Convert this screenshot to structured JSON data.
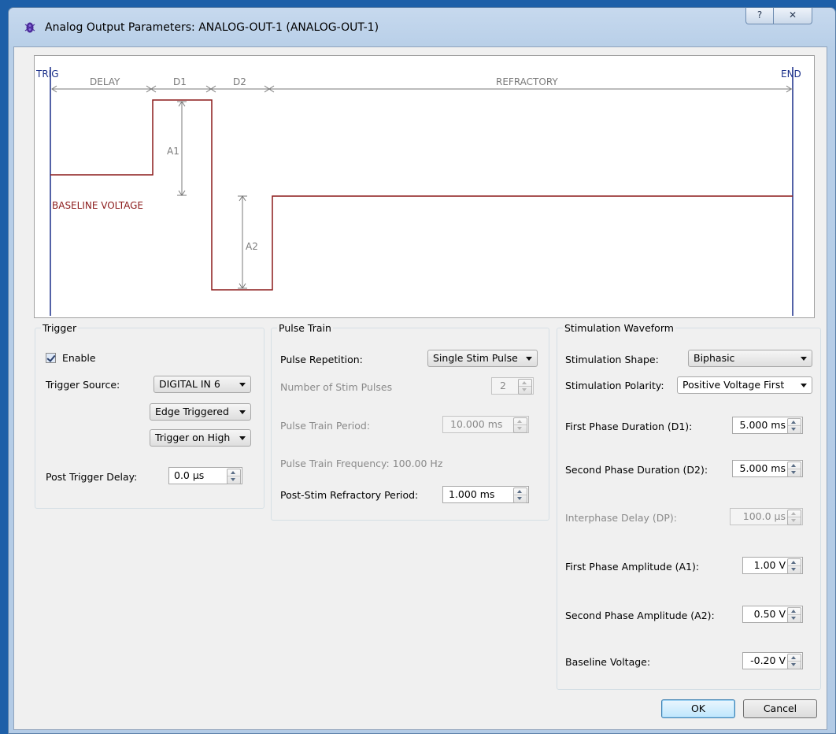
{
  "window": {
    "title": "Analog Output Parameters: ANALOG-OUT-1 (ANALOG-OUT-1)",
    "help_glyph": "?",
    "close_glyph": "✕"
  },
  "waveform": {
    "trig": "TRIG",
    "end": "END",
    "delay": "DELAY",
    "d1": "D1",
    "d2": "D2",
    "refractory": "REFRACTORY",
    "a1": "A1",
    "a2": "A2",
    "baseline": "BASELINE VOLTAGE",
    "colors": {
      "trace": "#8b1a1a",
      "marker": "#1a2f8a",
      "dim": "#7a7a7a"
    }
  },
  "trigger": {
    "title": "Trigger",
    "enable_label": "Enable",
    "enable_checked": true,
    "source_label": "Trigger Source:",
    "source_value": "DIGITAL IN 6",
    "edge_value": "Edge Triggered",
    "level_value": "Trigger on High",
    "delay_label": "Post Trigger Delay:",
    "delay_value": "0.0 µs"
  },
  "pulse_train": {
    "title": "Pulse Train",
    "repetition_label": "Pulse Repetition:",
    "repetition_value": "Single Stim Pulse",
    "num_pulses_label": "Number of Stim Pulses",
    "num_pulses_value": "2",
    "period_label": "Pulse Train Period:",
    "period_value": "10.000 ms",
    "frequency_text": "Pulse Train Frequency: 100.00 Hz",
    "refractory_label": "Post-Stim Refractory Period:",
    "refractory_value": "1.000 ms"
  },
  "stim_waveform": {
    "title": "Stimulation Waveform",
    "shape_label": "Stimulation Shape:",
    "shape_value": "Biphasic",
    "polarity_label": "Stimulation Polarity:",
    "polarity_value": "Positive Voltage First",
    "d1_label": "First Phase Duration (D1):",
    "d1_value": "5.000 ms",
    "d2_label": "Second Phase Duration (D2):",
    "d2_value": "5.000 ms",
    "dp_label": "Interphase Delay (DP):",
    "dp_value": "100.0 µs",
    "a1_label": "First Phase Amplitude (A1):",
    "a1_value": "1.00 V",
    "a2_label": "Second Phase Amplitude (A2):",
    "a2_value": "0.50 V",
    "baseline_label": "Baseline Voltage:",
    "baseline_value": "-0.20 V"
  },
  "buttons": {
    "ok": "OK",
    "cancel": "Cancel"
  }
}
